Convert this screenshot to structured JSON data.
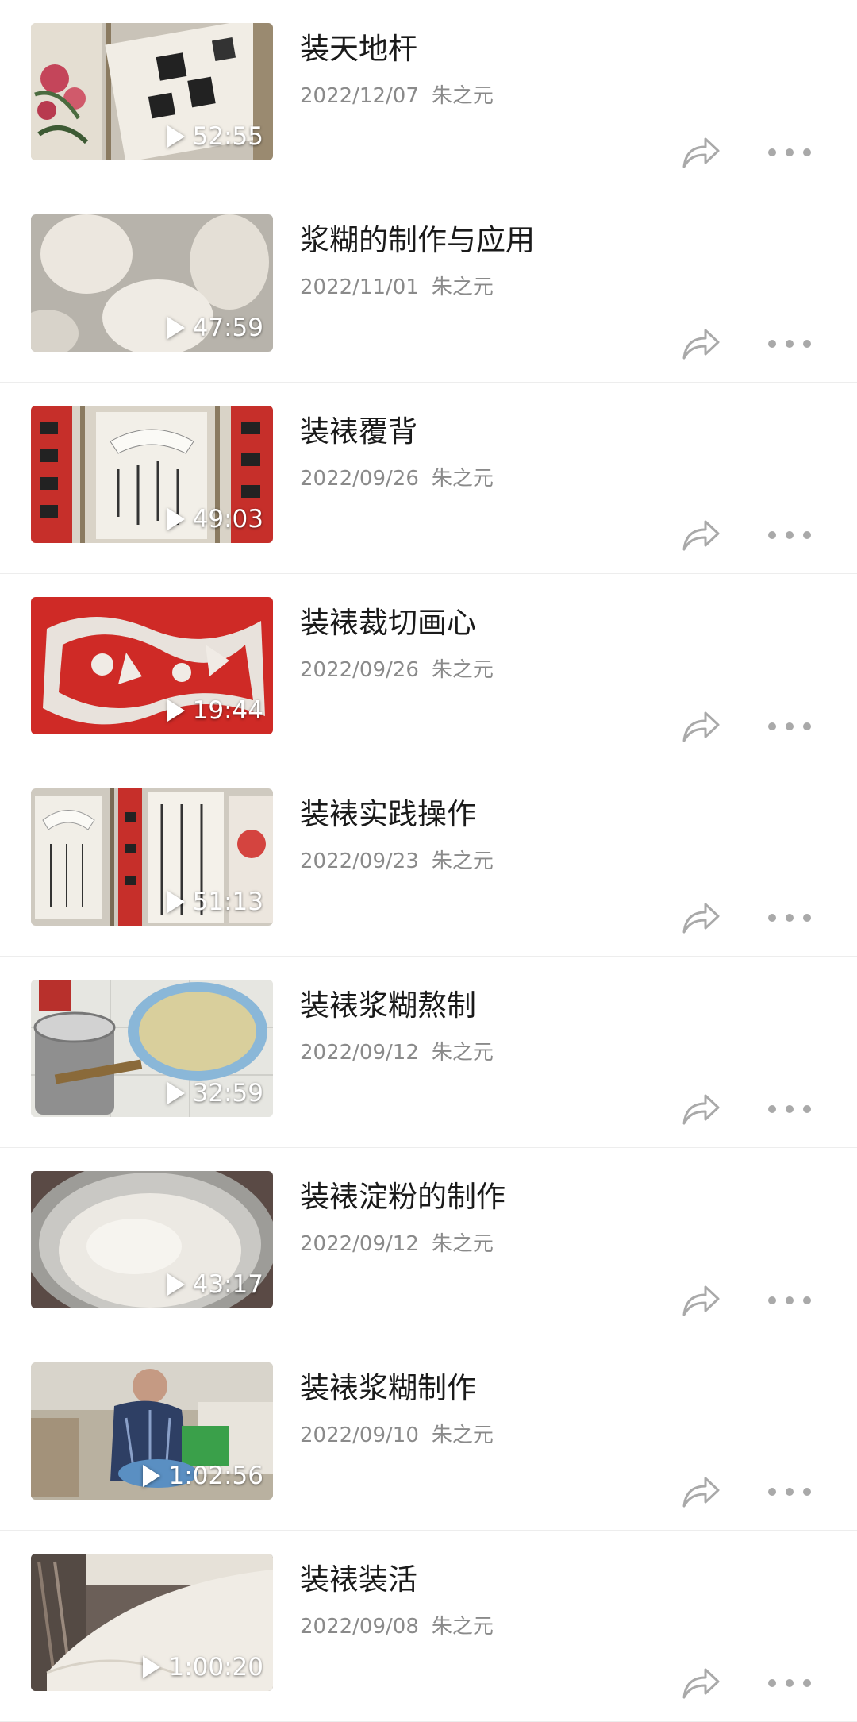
{
  "videos": [
    {
      "title": "装天地杆",
      "date": "2022/12/07",
      "author": "朱之元",
      "duration": "52:55",
      "thumb_icon": "calligraphy-scroll-thumbnail"
    },
    {
      "title": "浆糊的制作与应用",
      "date": "2022/11/01",
      "author": "朱之元",
      "duration": "47:59",
      "thumb_icon": "paste-dough-thumbnail"
    },
    {
      "title": "装裱覆背",
      "date": "2022/09/26",
      "author": "朱之元",
      "duration": "49:03",
      "thumb_icon": "calligraphy-couplets-thumbnail"
    },
    {
      "title": "装裱裁切画心",
      "date": "2022/09/26",
      "author": "朱之元",
      "duration": "19:44",
      "thumb_icon": "red-papercut-thumbnail"
    },
    {
      "title": "装裱实践操作",
      "date": "2022/09/23",
      "author": "朱之元",
      "duration": "51:13",
      "thumb_icon": "calligraphy-wall-thumbnail"
    },
    {
      "title": "装裱浆糊熬制",
      "date": "2022/09/12",
      "author": "朱之元",
      "duration": "32:59",
      "thumb_icon": "paste-bowl-thumbnail"
    },
    {
      "title": "装裱淀粉的制作",
      "date": "2022/09/12",
      "author": "朱之元",
      "duration": "43:17",
      "thumb_icon": "flour-pot-thumbnail"
    },
    {
      "title": "装裱浆糊制作",
      "date": "2022/09/10",
      "author": "朱之元",
      "duration": "1:02:56",
      "thumb_icon": "craftsman-working-thumbnail"
    },
    {
      "title": "装裱装活",
      "date": "2022/09/08",
      "author": "朱之元",
      "duration": "1:00:20",
      "thumb_icon": "paper-roll-thumbnail"
    }
  ],
  "colors": {
    "title": "#1a1a1a",
    "meta": "#8a8a8a",
    "icon": "#a9a9a9",
    "divider": "#ededed"
  }
}
